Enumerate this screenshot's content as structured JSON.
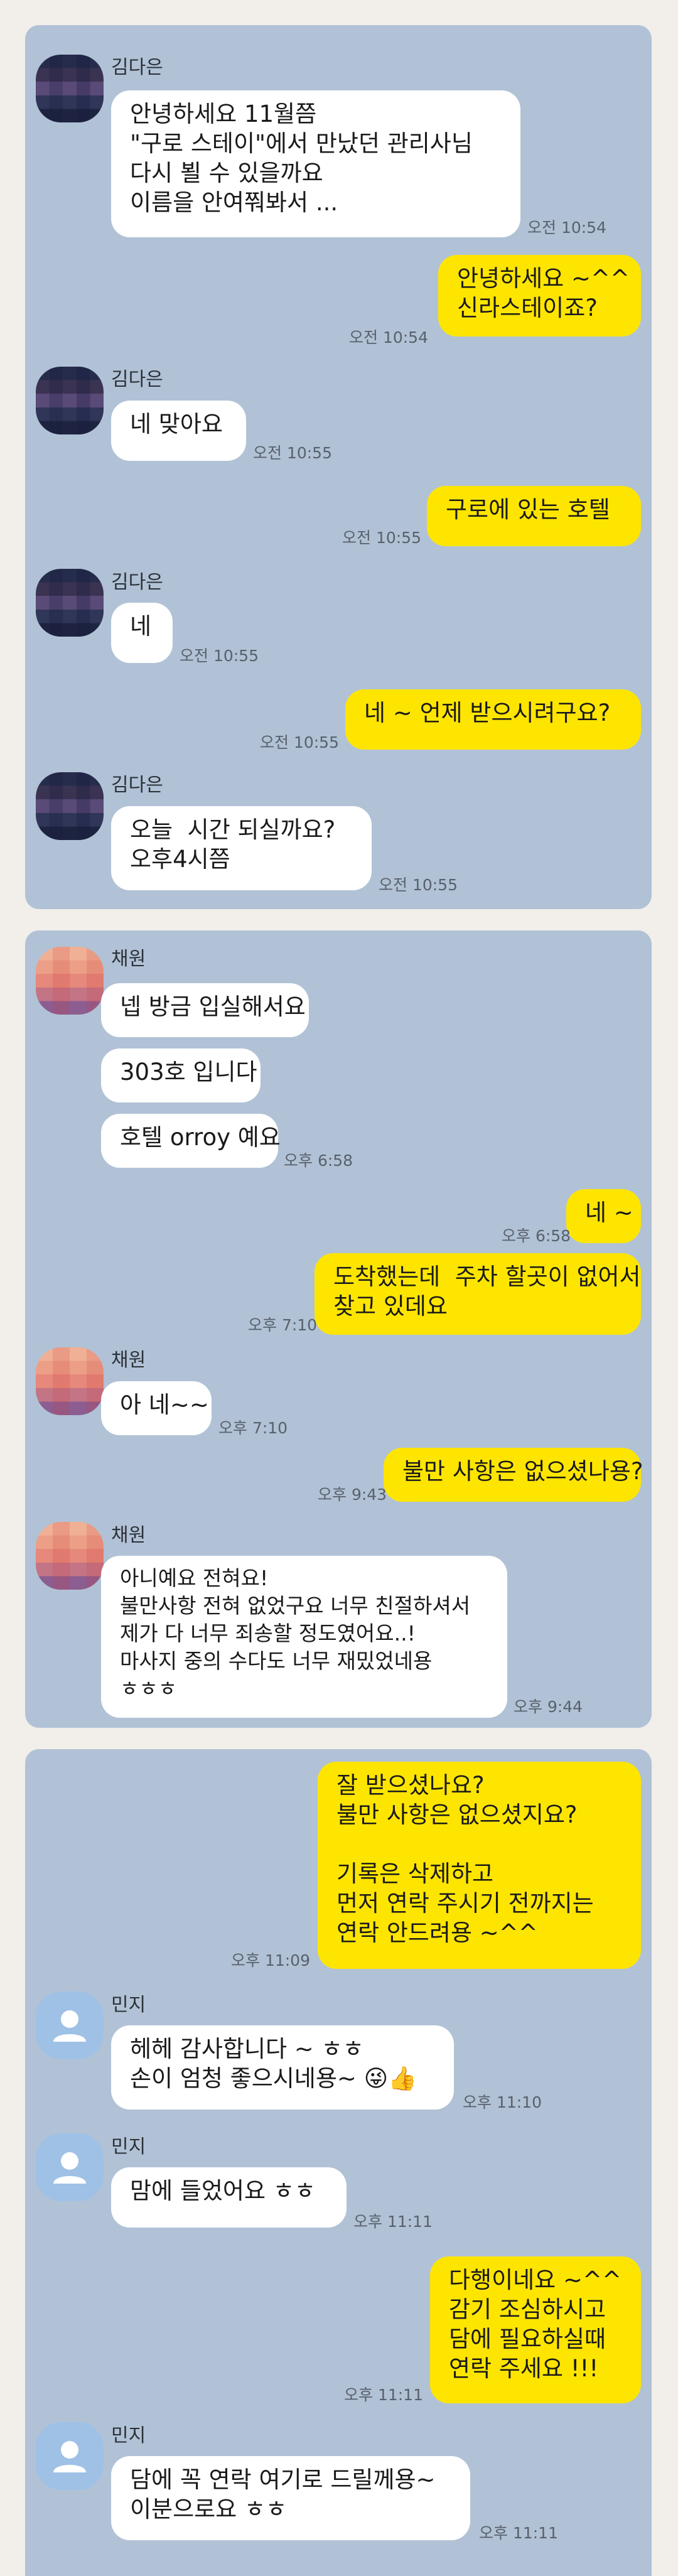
{
  "chats": [
    {
      "contact_name": "김다은",
      "messages": [
        {
          "from": "other",
          "text": "안녕하세요 11월쯤\n\"구로 스테이\"에서 만났던 관리사님\n다시 뵐 수 있을까요\n이름을 안여쭤봐서 ...",
          "time": "오전 10:54"
        },
        {
          "from": "me",
          "text": "안녕하세요 ~^^\n신라스테이죠?",
          "time": "오전 10:54"
        },
        {
          "from": "other",
          "text": "네 맞아요",
          "time": "오전 10:55"
        },
        {
          "from": "me",
          "text": "구로에 있는 호텔",
          "time": "오전 10:55"
        },
        {
          "from": "other",
          "text": "네",
          "time": "오전 10:55"
        },
        {
          "from": "me",
          "text": "네 ~ 언제 받으시려구요?",
          "time": "오전 10:55"
        },
        {
          "from": "other",
          "text": "오늘  시간 되실까요?\n오후4시쯤",
          "time": "오전 10:55"
        }
      ]
    },
    {
      "contact_name": "채원",
      "messages": [
        {
          "from": "other",
          "text": "넵 방금 입실해서요"
        },
        {
          "from": "other",
          "text": "303호 입니다"
        },
        {
          "from": "other",
          "text": "호텔 orroy 예요",
          "time": "오후 6:58"
        },
        {
          "from": "me",
          "text": "네 ~",
          "time": "오후 6:58"
        },
        {
          "from": "me",
          "text": "도착했는데  주차 할곳이 없어서\n찾고 있데요",
          "time": "오후 7:10"
        },
        {
          "from": "other",
          "text": "아 네~~",
          "time": "오후 7:10"
        },
        {
          "from": "me",
          "text": "불만 사항은 없으셨나용?",
          "time": "오후 9:43"
        },
        {
          "from": "other",
          "text": "아니예요 전혀요!\n불만사항 전혀 없었구요 너무 친절하셔서\n제가 다 너무 죄송할 정도였어요..!\n마사지 중의 수다도 너무 재밌었네용\nㅎㅎㅎ",
          "time": "오후 9:44"
        }
      ]
    },
    {
      "contact_name": "민지",
      "messages": [
        {
          "from": "me",
          "text": "잘 받으셨나요?\n불만 사항은 없으셨지요?\n\n기록은 삭제하고\n먼저 연락 주시기 전까지는\n연락 안드려용 ~^^",
          "time": "오후 11:09"
        },
        {
          "from": "other",
          "text": "헤헤 감사합니다 ~ ㅎㅎ\n손이 엄청 좋으시네용~ 😜👍",
          "time": "오후 11:10"
        },
        {
          "from": "other",
          "text": "맘에 들었어요 ㅎㅎ",
          "time": "오후 11:11"
        },
        {
          "from": "me",
          "text": "다행이네요 ~^^\n감기 조심하시고\n담에 필요하실때\n연락 주세요 !!!",
          "time": "오후 11:11"
        },
        {
          "from": "other",
          "text": "담에 꼭 연락 여기로 드릴께용~\n이분으로요 ㅎㅎ",
          "time": "오후 11:11"
        }
      ]
    }
  ],
  "colors": {
    "background": "#f2eeea",
    "chat_background": "#b1c2d6",
    "my_bubble": "#fee500",
    "other_bubble": "#ffffff"
  },
  "icons": {
    "avatar_1": "pixelated-profile-photo",
    "avatar_2": "pixelated-profile-photo",
    "avatar_3": "default-person-icon"
  }
}
